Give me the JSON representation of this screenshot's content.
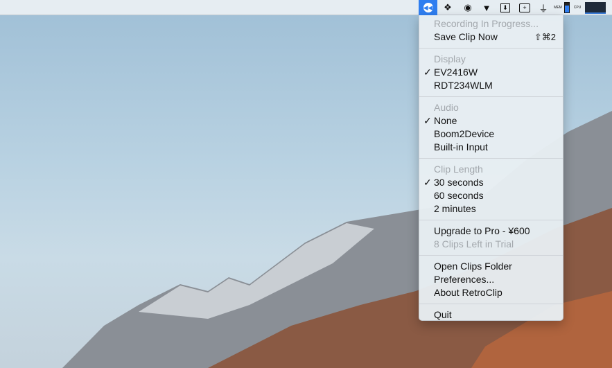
{
  "menubar": {
    "icons": [
      "retroclip-icon",
      "dropbox-icon",
      "sync-icon",
      "tophat-icon",
      "download-icon",
      "screenshot-icon",
      "broom-icon",
      "memory-meter-icon",
      "cpu-meter-icon"
    ],
    "mem_label": "MEM",
    "cpu_label": "CPU",
    "accent": "#2f7ef0"
  },
  "menu": {
    "recording": "Recording In Progress...",
    "save_clip": "Save Clip Now",
    "save_shortcut": "⇧⌘2",
    "display_header": "Display",
    "displays": [
      "EV2416W",
      "RDT234WLM"
    ],
    "audio_header": "Audio",
    "audio": [
      "None",
      "Boom2Device",
      "Built-in Input"
    ],
    "length_header": "Clip Length",
    "lengths": [
      "30 seconds",
      "60 seconds",
      "2 minutes"
    ],
    "check": "✓",
    "upgrade": "Upgrade to Pro - ¥600",
    "clips_left": "8 Clips Left in Trial",
    "open_folder": "Open Clips Folder",
    "preferences": "Preferences...",
    "about": "About RetroClip",
    "quit": "Quit"
  }
}
